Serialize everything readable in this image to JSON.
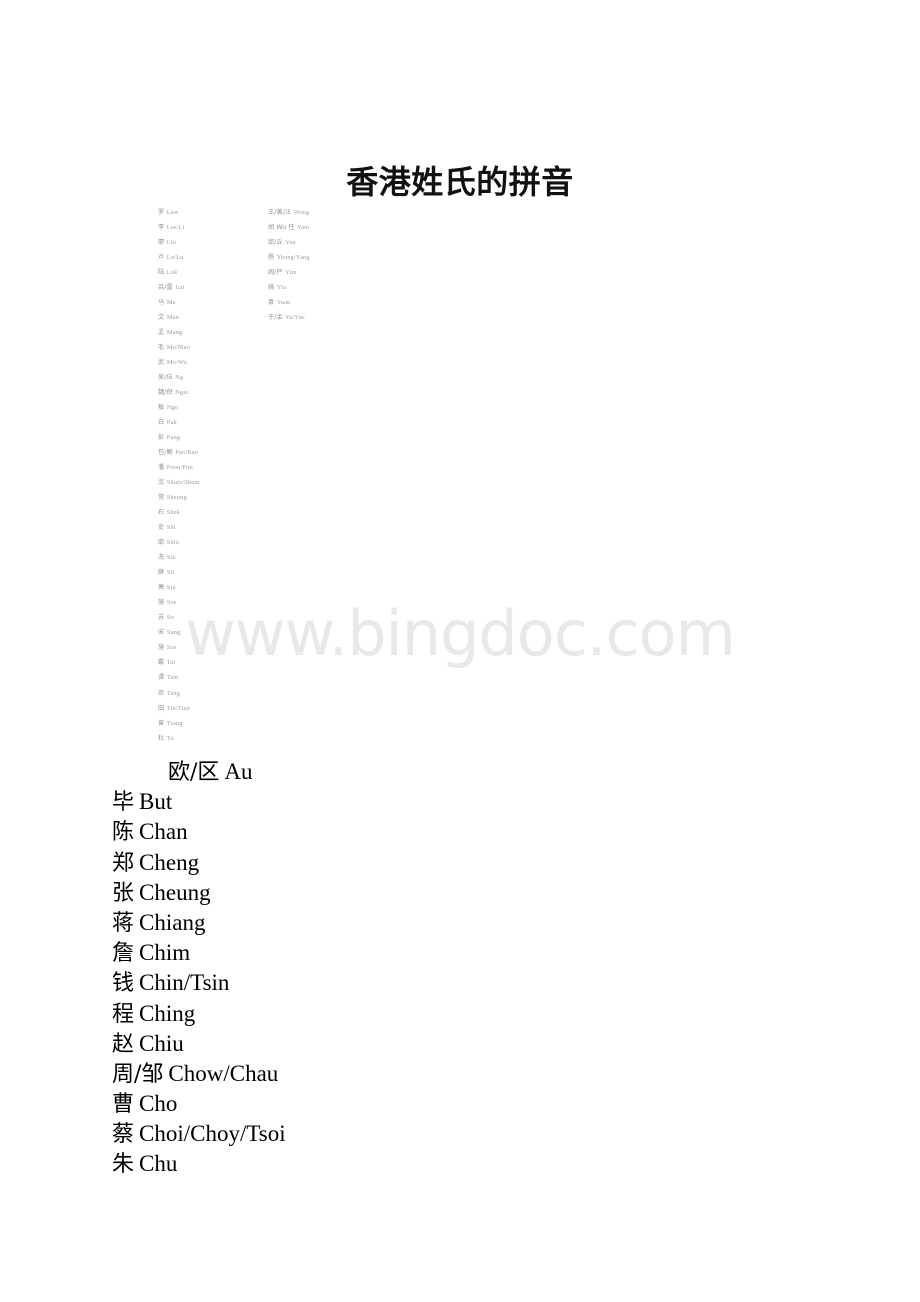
{
  "document": {
    "title": "香港姓氏的拼音",
    "watermark": "www.bingdoc.com"
  },
  "embedded_table": {
    "left_column": [
      {
        "han": "罗",
        "rom": "Law"
      },
      {
        "han": "李",
        "rom": "Lee/Li"
      },
      {
        "han": "廖",
        "rom": "Liu"
      },
      {
        "han": "卢",
        "rom": "Lo/Lu"
      },
      {
        "han": "陆",
        "rom": "Luk"
      },
      {
        "han": "吕/雷",
        "rom": "Lui"
      },
      {
        "han": "马",
        "rom": "Ma"
      },
      {
        "han": "文",
        "rom": "Man"
      },
      {
        "han": "孟",
        "rom": "Mang"
      },
      {
        "han": "毛",
        "rom": "Mo/Mao"
      },
      {
        "han": "武",
        "rom": "Mo/Wu"
      },
      {
        "han": "吴/伍",
        "rom": "Ng"
      },
      {
        "han": "魏/倪",
        "rom": "Ngai"
      },
      {
        "han": "敖",
        "rom": "Ngo"
      },
      {
        "han": "白",
        "rom": "Pak"
      },
      {
        "han": "彭",
        "rom": "Pang"
      },
      {
        "han": "包/鲍",
        "rom": "Pao/Bao"
      },
      {
        "han": "潘",
        "rom": "Poon/Pun"
      },
      {
        "han": "沈",
        "rom": "Shum/Shum"
      },
      {
        "han": "常",
        "rom": "Sheung"
      },
      {
        "han": "石",
        "rom": "Shek"
      },
      {
        "han": "史",
        "rom": "Shi"
      },
      {
        "han": "邵",
        "rom": "Shiu"
      },
      {
        "han": "冼",
        "rom": "Sin"
      },
      {
        "han": "薛",
        "rom": "Sit"
      },
      {
        "han": "萧",
        "rom": "Siu"
      },
      {
        "han": "施",
        "rom": "Sze"
      },
      {
        "han": "苏",
        "rom": "So"
      },
      {
        "han": "宋",
        "rom": "Sung"
      },
      {
        "han": "施",
        "rom": "Sze"
      },
      {
        "han": "戴",
        "rom": "Tai"
      },
      {
        "han": "谭",
        "rom": "Tam"
      },
      {
        "han": "邓",
        "rom": "Tang"
      },
      {
        "han": "田",
        "rom": "Tin/Tian"
      },
      {
        "han": "曾",
        "rom": "Tsang"
      },
      {
        "han": "杜",
        "rom": "To"
      }
    ],
    "right_column": [
      {
        "han": "王/黄/汪",
        "rom": "Wong"
      },
      {
        "han": "胡 Wu 任",
        "rom": "Yam"
      },
      {
        "han": "邱/丘",
        "rom": "Yau"
      },
      {
        "han": "杨",
        "rom": "Yeung/Yang"
      },
      {
        "han": "阎/严",
        "rom": "Yim"
      },
      {
        "han": "姚",
        "rom": "Yiu"
      },
      {
        "han": "袁",
        "rom": "Yuan"
      },
      {
        "han": "于/余",
        "rom": "Yu/Yue"
      }
    ]
  },
  "main_list": [
    {
      "han": "欧/区",
      "rom": "Au",
      "indented": true
    },
    {
      "han": "毕",
      "rom": "But",
      "indented": false
    },
    {
      "han": "陈",
      "rom": "Chan",
      "indented": false
    },
    {
      "han": "郑",
      "rom": "Cheng",
      "indented": false
    },
    {
      "han": "张",
      "rom": "Cheung",
      "indented": false
    },
    {
      "han": "蒋",
      "rom": "Chiang",
      "indented": false
    },
    {
      "han": "詹",
      "rom": "Chim",
      "indented": false
    },
    {
      "han": "钱",
      "rom": "Chin/Tsin",
      "indented": false
    },
    {
      "han": "程",
      "rom": "Ching",
      "indented": false
    },
    {
      "han": "赵",
      "rom": "Chiu",
      "indented": false
    },
    {
      "han": "周/邹",
      "rom": "Chow/Chau",
      "indented": false
    },
    {
      "han": "曹",
      "rom": "Cho",
      "indented": false
    },
    {
      "han": "蔡",
      "rom": "Choi/Choy/Tsoi",
      "indented": false
    },
    {
      "han": "朱",
      "rom": "Chu",
      "indented": false
    }
  ]
}
